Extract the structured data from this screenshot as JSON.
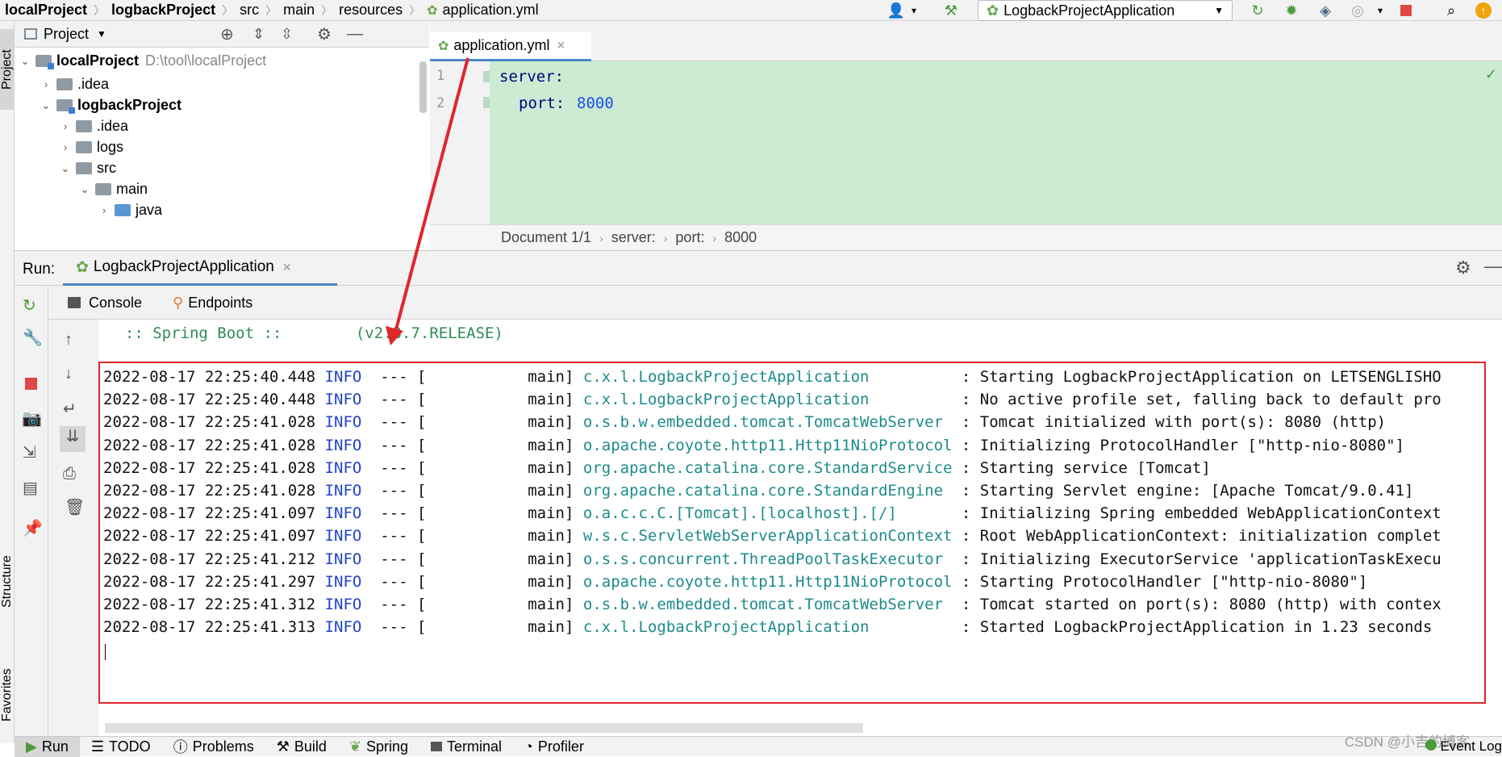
{
  "navbar": {
    "crumbs": [
      "localProject",
      "logbackProject",
      "src",
      "main",
      "resources",
      "application.yml"
    ],
    "run_config": "LogbackProjectApplication"
  },
  "left_stripe": {
    "project_label": "Project",
    "structure_label": "Structure",
    "favorites_label": "Favorites"
  },
  "project_panel": {
    "title": "Project",
    "tree": [
      {
        "label": "localProject",
        "path": "D:\\tool\\localProject"
      },
      {
        "label": ".idea"
      },
      {
        "label": "logbackProject"
      },
      {
        "label": ".idea"
      },
      {
        "label": "logs"
      },
      {
        "label": "src"
      },
      {
        "label": "main"
      },
      {
        "label": "java"
      }
    ]
  },
  "editor": {
    "tab_label": "application.yml",
    "line_numbers": [
      "1",
      "2"
    ],
    "line1_key": "server:",
    "line2_key": "port:",
    "line2_value": "8000",
    "status": {
      "doc": "Document 1/1",
      "crumb1": "server:",
      "crumb2": "port:",
      "crumb3": "8000"
    }
  },
  "run_panel": {
    "label": "Run:",
    "tab_label": "LogbackProjectApplication",
    "subtabs": {
      "console": "Console",
      "endpoints": "Endpoints"
    },
    "banner": "  :: Spring Boot ::        (v2.3.7.RELEASE)",
    "log": [
      {
        "ts": "2022-08-17 22:25:40.448",
        "level": "INFO",
        "thread": "main",
        "logger": "c.x.l.LogbackProjectApplication         ",
        "msg": "Starting LogbackProjectApplication on LETSENGLISHO"
      },
      {
        "ts": "2022-08-17 22:25:40.448",
        "level": "INFO",
        "thread": "main",
        "logger": "c.x.l.LogbackProjectApplication         ",
        "msg": "No active profile set, falling back to default pro"
      },
      {
        "ts": "2022-08-17 22:25:41.028",
        "level": "INFO",
        "thread": "main",
        "logger": "o.s.b.w.embedded.tomcat.TomcatWebServer ",
        "msg": "Tomcat initialized with port(s): 8080 (http)"
      },
      {
        "ts": "2022-08-17 22:25:41.028",
        "level": "INFO",
        "thread": "main",
        "logger": "o.apache.coyote.http11.Http11NioProtocol",
        "msg": "Initializing ProtocolHandler [\"http-nio-8080\"]"
      },
      {
        "ts": "2022-08-17 22:25:41.028",
        "level": "INFO",
        "thread": "main",
        "logger": "org.apache.catalina.core.StandardService",
        "msg": "Starting service [Tomcat]"
      },
      {
        "ts": "2022-08-17 22:25:41.028",
        "level": "INFO",
        "thread": "main",
        "logger": "org.apache.catalina.core.StandardEngine ",
        "msg": "Starting Servlet engine: [Apache Tomcat/9.0.41]"
      },
      {
        "ts": "2022-08-17 22:25:41.097",
        "level": "INFO",
        "thread": "main",
        "logger": "o.a.c.c.C.[Tomcat].[localhost].[/]      ",
        "msg": "Initializing Spring embedded WebApplicationContext"
      },
      {
        "ts": "2022-08-17 22:25:41.097",
        "level": "INFO",
        "thread": "main",
        "logger": "w.s.c.ServletWebServerApplicationContext",
        "msg": "Root WebApplicationContext: initialization complet"
      },
      {
        "ts": "2022-08-17 22:25:41.212",
        "level": "INFO",
        "thread": "main",
        "logger": "o.s.s.concurrent.ThreadPoolTaskExecutor ",
        "msg": "Initializing ExecutorService 'applicationTaskExecu"
      },
      {
        "ts": "2022-08-17 22:25:41.297",
        "level": "INFO",
        "thread": "main",
        "logger": "o.apache.coyote.http11.Http11NioProtocol",
        "msg": "Starting ProtocolHandler [\"http-nio-8080\"]"
      },
      {
        "ts": "2022-08-17 22:25:41.312",
        "level": "INFO",
        "thread": "main",
        "logger": "o.s.b.w.embedded.tomcat.TomcatWebServer ",
        "msg": "Tomcat started on port(s): 8080 (http) with contex"
      },
      {
        "ts": "2022-08-17 22:25:41.313",
        "level": "INFO",
        "thread": "main",
        "logger": "c.x.l.LogbackProjectApplication         ",
        "msg": "Started LogbackProjectApplication in 1.23 seconds"
      }
    ]
  },
  "bottom_bar": {
    "tabs": [
      "Run",
      "TODO",
      "Problems",
      "Build",
      "Spring",
      "Terminal",
      "Profiler"
    ],
    "event_log": "Event Log",
    "watermark": "CSDN @小吉的博客"
  },
  "colors": {
    "accent": "#4a86c8",
    "highlight_bg": "#cdebd3",
    "annotation_red": "#e0262b",
    "info_blue": "#1f43c9",
    "logger_teal": "#1e8b8b"
  }
}
